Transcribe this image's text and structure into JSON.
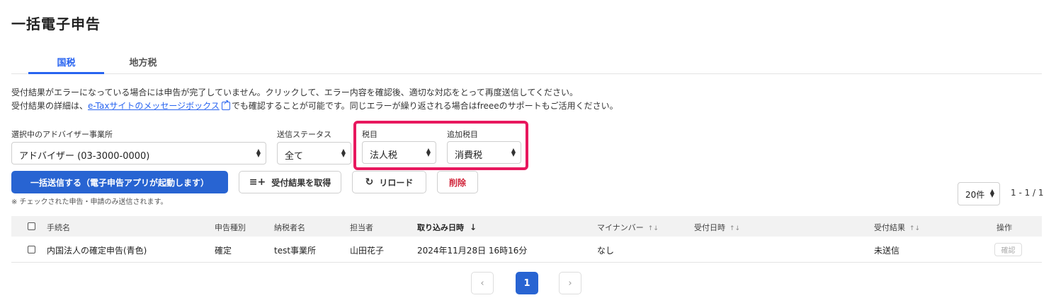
{
  "page": {
    "title": "一括電子申告"
  },
  "tabs": [
    {
      "label": "国税",
      "active": true
    },
    {
      "label": "地方税",
      "active": false
    }
  ],
  "notice": {
    "line1": "受付結果がエラーになっている場合には申告が完了していません。クリックして、エラー内容を確認後、適切な対応をとって再度送信してください。",
    "line2_pre": "受付結果の詳細は、",
    "line2_link": "e-Taxサイトのメッセージボックス",
    "line2_post": "でも確認することが可能です。同じエラーが繰り返される場合はfreeeのサポートもご活用ください。"
  },
  "filters": {
    "advisor": {
      "label": "選択中のアドバイザー事業所",
      "value": "アドバイザー (03-3000-0000)"
    },
    "status": {
      "label": "送信ステータス",
      "value": "全て"
    },
    "tax_item": {
      "label": "税目",
      "value": "法人税"
    },
    "additional_tax_item": {
      "label": "追加税目",
      "value": "消費税"
    }
  },
  "highlight_color": "#e8185e",
  "actions": {
    "bulk_send": "一括送信する（電子申告アプリが起動します）",
    "fetch_results": "受付結果を取得",
    "reload": "リロード",
    "delete": "削除",
    "footnote": "※ チェックされた申告・申請のみ送信されます。"
  },
  "pagination": {
    "per_page": "20件",
    "range": "1 - 1 / 1",
    "current": "1",
    "prev_icon": "‹",
    "next_icon": "›"
  },
  "table": {
    "headers": {
      "procedure": "手続名",
      "filing_type": "申告種別",
      "taxpayer": "納税者名",
      "assignee": "担当者",
      "import_datetime": "取り込み日時",
      "my_number": "マイナンバー",
      "received_datetime": "受付日時",
      "result": "受付結果",
      "operation": "操作"
    },
    "rows": [
      {
        "procedure": "内国法人の確定申告(青色)",
        "filing_type": "確定",
        "taxpayer": "test事業所",
        "assignee": "山田花子",
        "import_datetime": "2024年11月28日 16時16分",
        "my_number": "なし",
        "received_datetime": "",
        "result": "未送信",
        "operation": "確認"
      }
    ]
  },
  "colors": {
    "primary": "#2864d2",
    "tab_active": "#2864f0",
    "danger": "#d0243a"
  }
}
